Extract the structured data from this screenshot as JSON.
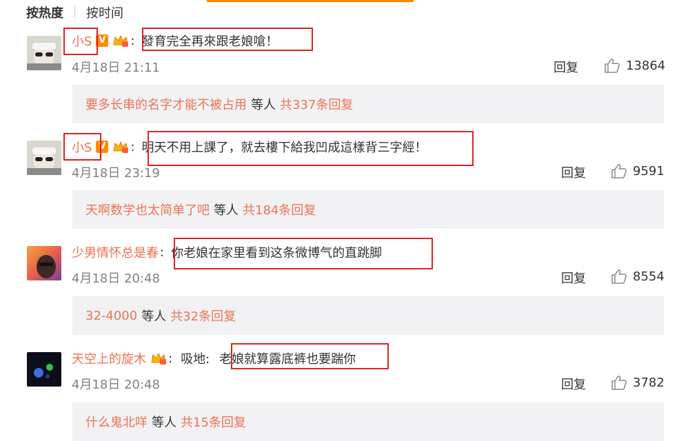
{
  "sort": {
    "active": "按热度",
    "inactive": "按时间"
  },
  "comments": [
    {
      "name": "小S",
      "verified": "V",
      "text": "發育完全再來跟老娘嗆！",
      "time": "4月18日 21:11",
      "reply_label": "回复",
      "likes": "13864",
      "sub_users": "要多长串的名字才能不被占用",
      "sub_mid": "等人",
      "sub_total": "共337条回复"
    },
    {
      "name": "小S",
      "verified": "V",
      "text": "明天不用上課了，就去樓下給我凹成這樣背三字經！",
      "time": "4月18日 23:19",
      "reply_label": "回复",
      "likes": "9591",
      "sub_users": "天啊数学也太简单了吧",
      "sub_mid": "等人",
      "sub_total": "共184条回复"
    },
    {
      "name": "少男情怀总是春",
      "text": "你老娘在家里看到这条微博气的直跳脚",
      "time": "4月18日 20:48",
      "reply_label": "回复",
      "likes": "8554",
      "sub_users": "32-4000",
      "sub_mid": "等人",
      "sub_total": "共32条回复"
    },
    {
      "name": "天空上的旋木",
      "prefix": "吸地:",
      "text": "老娘就算露底裤也要踹你",
      "time": "4月18日 20:48",
      "reply_label": "回复",
      "likes": "3782",
      "sub_users": "什么鬼北咩",
      "sub_mid": "等人",
      "sub_total": "共15条回复"
    }
  ],
  "colors": {
    "name": "#eb7350",
    "highlight_box": "#e02020",
    "reply_bg": "#f2f2f5",
    "vip": "#ff8a00"
  }
}
